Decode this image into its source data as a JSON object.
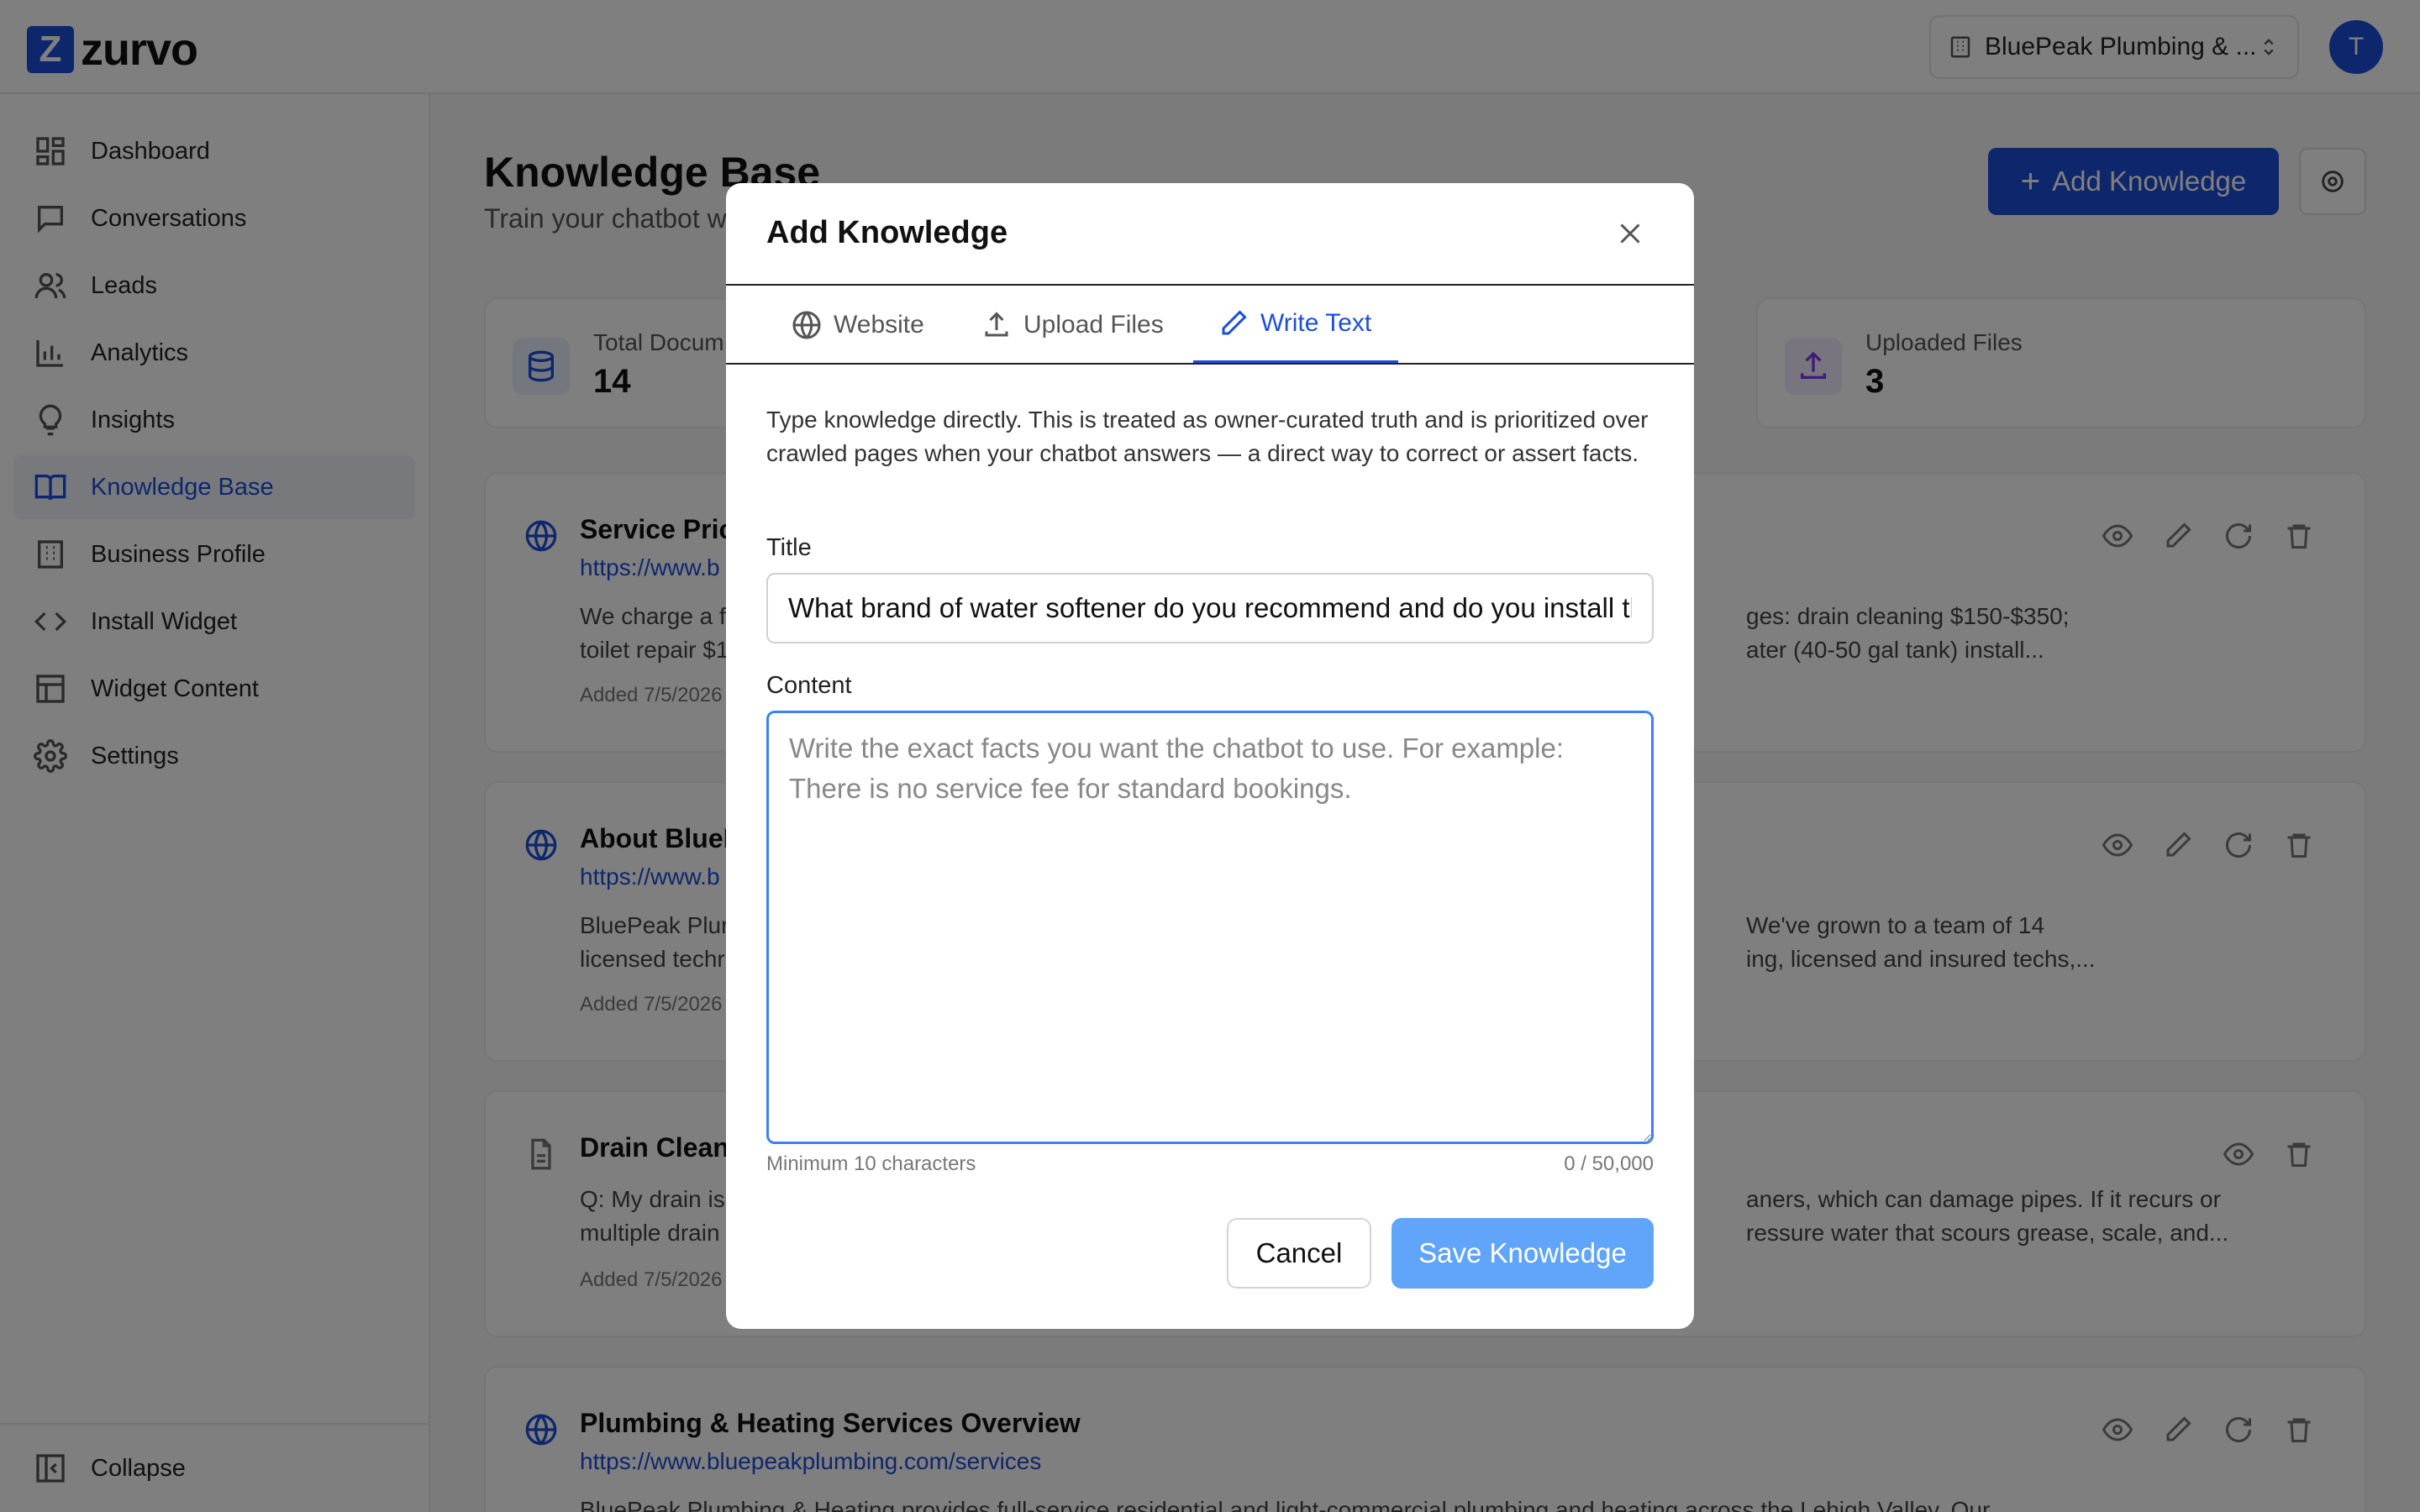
{
  "app": {
    "logo_letter": "Z",
    "name": "zurvo",
    "org": "BluePeak Plumbing & ...",
    "avatar_initial": "T"
  },
  "sidebar": {
    "items": [
      {
        "label": "Dashboard",
        "icon": "dashboard-icon"
      },
      {
        "label": "Conversations",
        "icon": "chat-icon"
      },
      {
        "label": "Leads",
        "icon": "users-icon"
      },
      {
        "label": "Analytics",
        "icon": "bar-chart-icon"
      },
      {
        "label": "Insights",
        "icon": "lightbulb-icon"
      },
      {
        "label": "Knowledge Base",
        "icon": "book-icon"
      },
      {
        "label": "Business Profile",
        "icon": "building-icon"
      },
      {
        "label": "Install Widget",
        "icon": "code-icon"
      },
      {
        "label": "Widget Content",
        "icon": "layout-icon"
      },
      {
        "label": "Settings",
        "icon": "gear-icon"
      }
    ],
    "active": "Knowledge Base",
    "collapse_label": "Collapse"
  },
  "page": {
    "title": "Knowledge Base",
    "subtitle": "Train your chatbot w",
    "add_button": "Add Knowledge"
  },
  "stats": [
    {
      "label": "Total Docum",
      "value": "14",
      "color": "#1d4ed8"
    },
    {
      "label": "Uploaded Files",
      "value": "3",
      "color": "#7c3aed"
    }
  ],
  "cards": [
    {
      "title": "Service Pric",
      "url": "https://www.b",
      "desc_left_1": "We charge a f",
      "desc_left_2": "toilet repair $1",
      "desc_right_1": "ges: drain cleaning $150-$350;",
      "desc_right_2": "ater (40-50 gal tank) install...",
      "date": "Added 7/5/2026"
    },
    {
      "title": "About BlueP",
      "url": "https://www.b",
      "desc_left_1": "BluePeak Plur",
      "desc_left_2": "licensed techr",
      "desc_right_1": "We've grown to a team of 14",
      "desc_right_2": "ing, licensed and insured techs,...",
      "date": "Added 7/5/2026"
    },
    {
      "title": "Drain Clean",
      "url": "",
      "desc_left_1": "Q: My drain is",
      "desc_left_2": "multiple drain",
      "desc_right_1": "aners, which can damage pipes. If it recurs or",
      "desc_right_2": "ressure water that scours grease, scale, and...",
      "date": "Added 7/5/2026"
    },
    {
      "title": "Plumbing & Heating Services Overview",
      "url": "https://www.bluepeakplumbing.com/services",
      "desc_left_1": "BluePeak Plumbing & Heating provides full-service residential and light-commercial plumbing and heating across the Lehigh Valley. Our",
      "desc_left_2": "",
      "desc_right_1": "",
      "desc_right_2": "",
      "date": ""
    }
  ],
  "modal": {
    "title": "Add Knowledge",
    "tabs": [
      {
        "label": "Website",
        "icon": "globe-icon"
      },
      {
        "label": "Upload Files",
        "icon": "upload-icon"
      },
      {
        "label": "Write Text",
        "icon": "pen-icon"
      }
    ],
    "active_tab": "Write Text",
    "intro": "Type knowledge directly. This is treated as owner-curated truth and is prioritized over crawled pages when your chatbot answers — a direct way to correct or assert facts.",
    "title_label": "Title",
    "title_value": "What brand of water softener do you recommend and do you install them?",
    "content_label": "Content",
    "content_value": "",
    "content_placeholder": "Write the exact facts you want the chatbot to use. For example: There is no service fee for standard bookings.",
    "min_hint": "Minimum 10 characters",
    "counter": "0 / 50,000",
    "cancel": "Cancel",
    "save": "Save Knowledge"
  }
}
